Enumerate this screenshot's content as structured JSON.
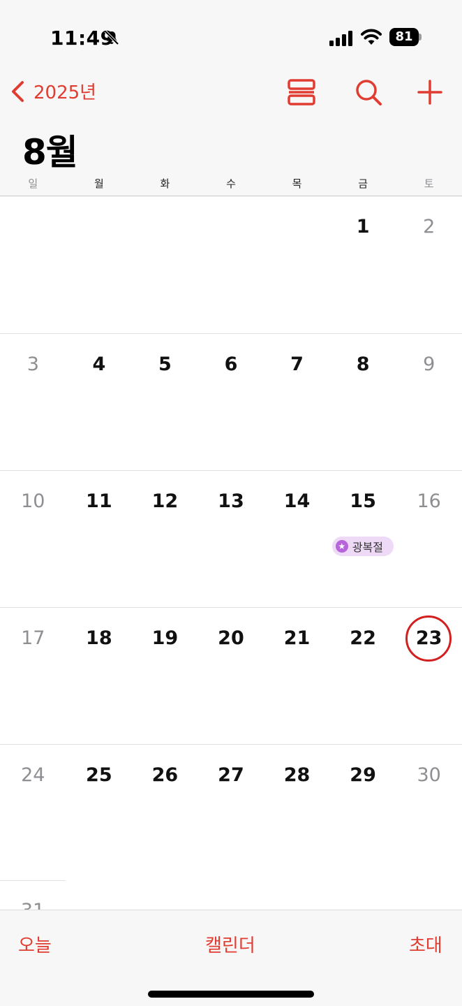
{
  "status_bar": {
    "time": "11:49",
    "battery": "81",
    "icons": [
      "bell-slash-icon",
      "cellular-signal-icon",
      "wifi-icon",
      "battery-icon"
    ]
  },
  "nav": {
    "back_label": "2025년",
    "icons": [
      "chevron-left-icon",
      "list-view-icon",
      "search-icon",
      "add-icon"
    ],
    "accent_color": "#e03c31"
  },
  "month_title": "8월",
  "weekdays": [
    "일",
    "월",
    "화",
    "수",
    "목",
    "금",
    "토"
  ],
  "weeks": [
    [
      "",
      "",
      "",
      "",
      "",
      "1",
      "2"
    ],
    [
      "3",
      "4",
      "5",
      "6",
      "7",
      "8",
      "9"
    ],
    [
      "10",
      "11",
      "12",
      "13",
      "14",
      "15",
      "16"
    ],
    [
      "17",
      "18",
      "19",
      "20",
      "21",
      "22",
      "23"
    ],
    [
      "24",
      "25",
      "26",
      "27",
      "28",
      "29",
      "30"
    ]
  ],
  "partial_week_first_day": "31",
  "today": "23",
  "event": {
    "day": "15",
    "title": "광복절",
    "icon": "star-icon",
    "color": "#eed9f7"
  },
  "toolbar": {
    "today": "오늘",
    "calendars": "캘린더",
    "invitations": "초대"
  }
}
